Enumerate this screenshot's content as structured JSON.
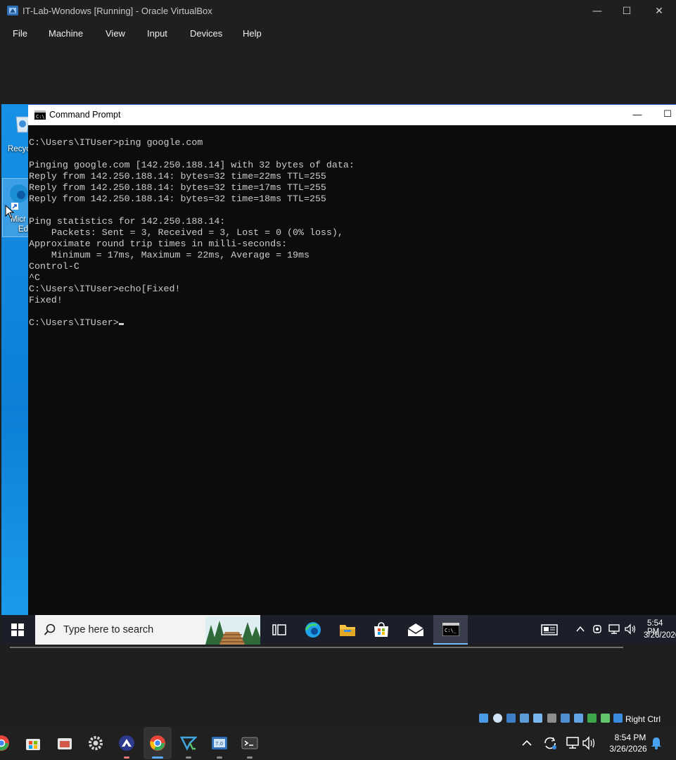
{
  "vbox": {
    "title": "IT-Lab-Wondows [Running] - Oracle VirtualBox",
    "menu": [
      "File",
      "Machine",
      "View",
      "Input",
      "Devices",
      "Help"
    ],
    "controls": {
      "minimize": "—",
      "maximize": "☐",
      "close": "✕"
    },
    "host_key": "Right Ctrl"
  },
  "desktop": {
    "icons": [
      {
        "label": "Recyc",
        "icon": "recycle-bin-icon"
      },
      {
        "label": "Micr",
        "label2": "Ed",
        "icon": "edge-icon"
      }
    ]
  },
  "cmd": {
    "title": "Command Prompt",
    "lines": [
      "C:\\Users\\ITUser>ping google.com",
      "",
      "Pinging google.com [142.250.188.14] with 32 bytes of data:",
      "Reply from 142.250.188.14: bytes=32 time=22ms TTL=255",
      "Reply from 142.250.188.14: bytes=32 time=17ms TTL=255",
      "Reply from 142.250.188.14: bytes=32 time=18ms TTL=255",
      "",
      "Ping statistics for 142.250.188.14:",
      "    Packets: Sent = 3, Received = 3, Lost = 0 (0% loss),",
      "Approximate round trip times in milli-seconds:",
      "    Minimum = 17ms, Maximum = 22ms, Average = 19ms",
      "Control-C",
      "^C",
      "C:\\Users\\ITUser>echo[Fixed!",
      "Fixed!",
      ""
    ],
    "prompt": "C:\\Users\\ITUser>"
  },
  "guest_taskbar": {
    "search_placeholder": "Type here to search",
    "time": "5:54 PM",
    "date": "3/26/2026"
  },
  "host_taskbar": {
    "time": "8:54 PM",
    "date": "3/26/2026"
  }
}
